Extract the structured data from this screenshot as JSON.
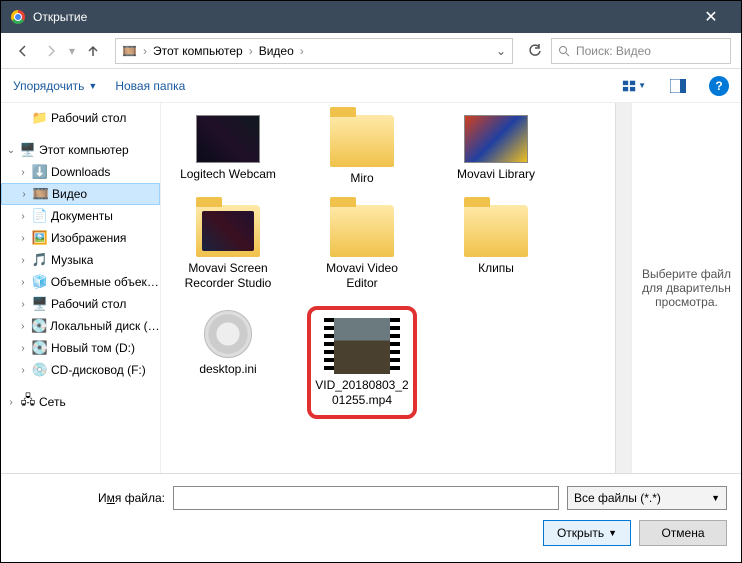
{
  "window": {
    "title": "Открытие"
  },
  "breadcrumb": {
    "root": "Этот компьютер",
    "folder": "Видео"
  },
  "search": {
    "placeholder": "Поиск: Видео"
  },
  "toolbar": {
    "organize": "Упорядочить",
    "newfolder": "Новая папка"
  },
  "tree": {
    "desktop": "Рабочий стол",
    "thispc": "Этот компьютер",
    "downloads": "Downloads",
    "video": "Видео",
    "documents": "Документы",
    "pictures": "Изображения",
    "music": "Музыка",
    "objects3d": "Объемные объекты",
    "desktop2": "Рабочий стол",
    "localdisk": "Локальный диск (C:)",
    "newvol": "Новый том (D:)",
    "cddrive": "CD-дисковод (F:)",
    "network": "Сеть"
  },
  "files": {
    "logitech": "Logitech Webcam",
    "miro": "Miro",
    "movavi_lib": "Movavi Library",
    "movavi_rec": "Movavi Screen Recorder Studio",
    "movavi_editor": "Movavi Video Editor",
    "clips": "Клипы",
    "desktop_ini": "desktop.ini",
    "video_file": "VID_20180803_201255.mp4"
  },
  "preview": {
    "text": "Выберите файл для дварительн просмотра."
  },
  "bottom": {
    "filename_label_pre": "И",
    "filename_label_u": "м",
    "filename_label_post": "я файла:",
    "filter": "Все файлы (*.*)",
    "open": "Открыть",
    "cancel": "Отмена"
  }
}
